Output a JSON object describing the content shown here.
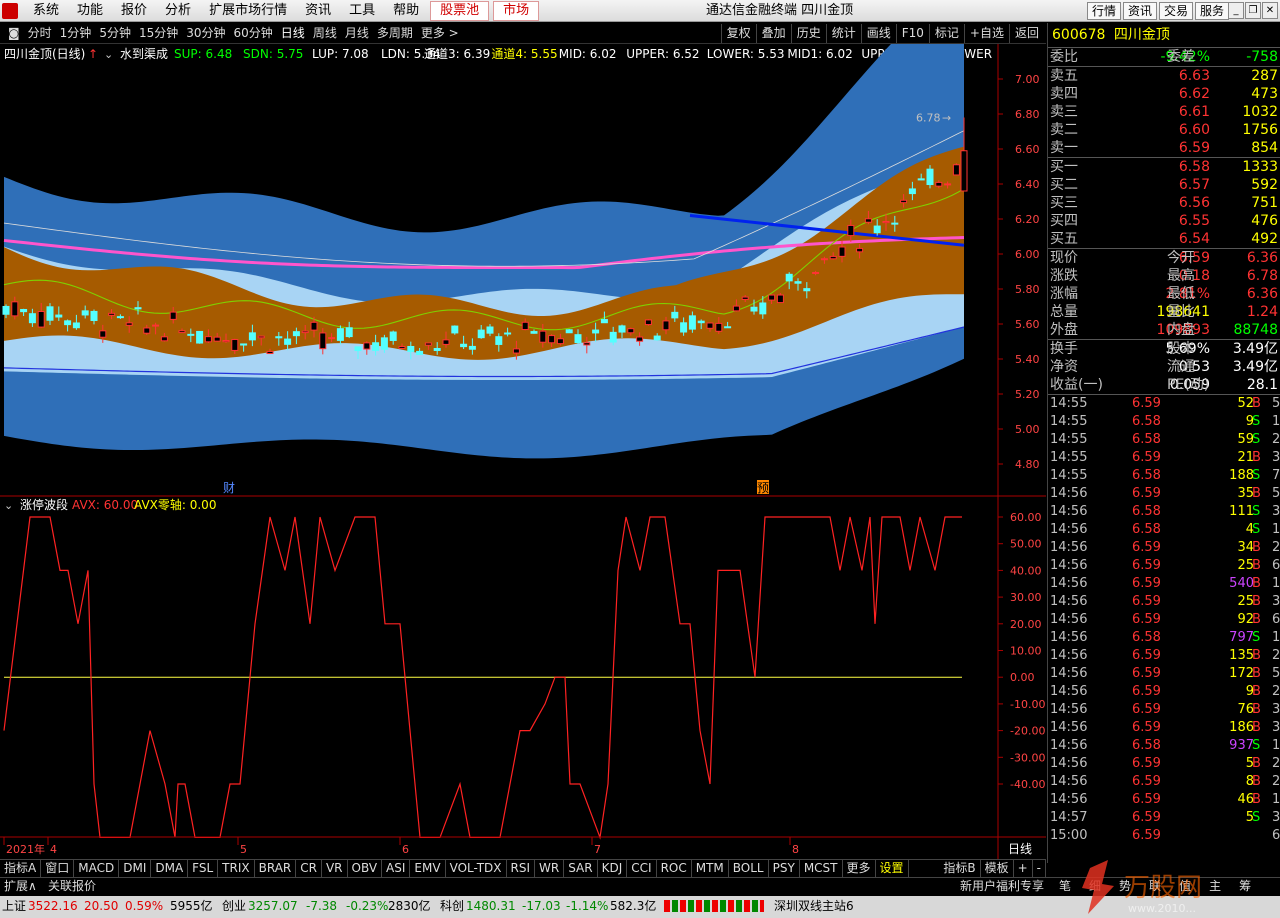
{
  "menubar": {
    "items": [
      "系统",
      "功能",
      "报价",
      "分析",
      "扩展市场行情",
      "资讯",
      "工具",
      "帮助"
    ],
    "red_items": [
      "股票池",
      "市场"
    ],
    "app_title": "通达信金融终端  四川金顶",
    "right_buttons": [
      "行情",
      "资讯",
      "交易",
      "服务"
    ]
  },
  "periodbar": {
    "items": [
      "分时",
      "1分钟",
      "5分钟",
      "15分钟",
      "30分钟",
      "60分钟",
      "日线",
      "周线",
      "月线",
      "多周期",
      "更多 >"
    ],
    "active": "日线",
    "right": [
      "复权",
      "叠加",
      "历史",
      "统计",
      "画线",
      "F10",
      "标记",
      "+自选",
      "返回"
    ]
  },
  "main_chart": {
    "title": "四川金顶(日线)",
    "indicator": "水到渠成",
    "params": [
      {
        "label": "SUP: 6.48",
        "color": "#00ff00"
      },
      {
        "label": "SDN: 5.75",
        "color": "#00ff00"
      },
      {
        "label": "LUP: 7.08",
        "color": "#ffffff"
      },
      {
        "label": "LDN: 5.34",
        "color": "#ffffff"
      }
    ],
    "params2": [
      {
        "label": "通道3: 6.39",
        "color": "#ffffff"
      },
      {
        "label": "通道4: 5.55",
        "color": "#ffff00"
      },
      {
        "label": "MID: 6.02",
        "color": "#ffffff"
      },
      {
        "label": "UPPER: 6.52",
        "color": "#ffffff"
      },
      {
        "label": "LOWER: 5.53",
        "color": "#ffffff"
      },
      {
        "label": "MID1: 6.02",
        "color": "#ffffff"
      },
      {
        "label": "UPPER1: 6.52",
        "color": "#ffffff"
      },
      {
        "label": "LOWER",
        "color": "#ffffff"
      }
    ],
    "y_ticks": [
      "7.00",
      "6.80",
      "6.60",
      "6.40",
      "6.20",
      "6.00",
      "5.80",
      "5.60",
      "5.40",
      "5.20",
      "5.00",
      "4.80"
    ],
    "y_tick_values": [
      7.0,
      6.8,
      6.6,
      6.4,
      6.2,
      6.0,
      5.8,
      5.6,
      5.4,
      5.2,
      5.0,
      4.8
    ],
    "max_label": "6.78",
    "marker_cai": "财",
    "marker_yu": "预"
  },
  "sub_chart": {
    "title": "涨停波段",
    "avx_label": "AVX: 60.00",
    "zero_label": "AVX零轴: 0.00",
    "y_ticks": [
      "60.00",
      "50.00",
      "40.00",
      "30.00",
      "20.00",
      "10.00",
      "0.00",
      "-10.00",
      "-20.00",
      "-30.00",
      "-40.00"
    ],
    "y_tick_values": [
      60,
      50,
      40,
      30,
      20,
      10,
      0,
      -10,
      -20,
      -30,
      -40
    ]
  },
  "x_axis": {
    "labels": [
      "2021年",
      "4",
      "5",
      "6",
      "7",
      "8"
    ],
    "period": "日线"
  },
  "quote": {
    "code": "600678",
    "name": "四川金顶",
    "weibi_label": "委比",
    "weibi": "-9.42%",
    "weicha_label": "委差",
    "weicha": "-758",
    "sells": [
      {
        "label": "卖五",
        "price": "6.63",
        "vol": "287"
      },
      {
        "label": "卖四",
        "price": "6.62",
        "vol": "473"
      },
      {
        "label": "卖三",
        "price": "6.61",
        "vol": "1032"
      },
      {
        "label": "卖二",
        "price": "6.60",
        "vol": "1756"
      },
      {
        "label": "卖一",
        "price": "6.59",
        "vol": "854"
      }
    ],
    "buys": [
      {
        "label": "买一",
        "price": "6.58",
        "vol": "1333"
      },
      {
        "label": "买二",
        "price": "6.57",
        "vol": "592"
      },
      {
        "label": "买三",
        "price": "6.56",
        "vol": "751"
      },
      {
        "label": "买四",
        "price": "6.55",
        "vol": "476"
      },
      {
        "label": "买五",
        "price": "6.54",
        "vol": "492"
      }
    ],
    "stats": [
      {
        "a": "现价",
        "b": "6.59",
        "c": "今开",
        "d": "6.36",
        "bcol": "#ff3333",
        "dcol": "#ff3333"
      },
      {
        "a": "涨跌",
        "b": "0.18",
        "c": "最高",
        "d": "6.78",
        "bcol": "#ff3333",
        "dcol": "#ff3333"
      },
      {
        "a": "涨幅",
        "b": "2.81%",
        "c": "最低",
        "d": "6.36",
        "bcol": "#ff3333",
        "dcol": "#ff3333"
      },
      {
        "a": "总量",
        "b": "198641",
        "c": "量比",
        "d": "1.24",
        "bcol": "#ffff00",
        "dcol": "#ff3333"
      },
      {
        "a": "外盘",
        "b": "109893",
        "c": "内盘",
        "d": "88748",
        "bcol": "#ff3333",
        "dcol": "#00ff00"
      }
    ],
    "stats2": [
      {
        "a": "换手",
        "b": "5.69%",
        "c": "股本",
        "d": "3.49亿",
        "bcol": "#ffffff",
        "dcol": "#ffffff"
      },
      {
        "a": "净资",
        "b": "0.53",
        "c": "流通",
        "d": "3.49亿",
        "bcol": "#ffffff",
        "dcol": "#ffffff"
      },
      {
        "a": "收益(一)",
        "b": "0.059",
        "c": "PE(动)",
        "d": "28.1",
        "bcol": "#ffffff",
        "dcol": "#ffffff"
      }
    ],
    "ticks": [
      {
        "t": "14:55",
        "p": "6.59",
        "v": "52",
        "s": "B",
        "n": "5"
      },
      {
        "t": "14:55",
        "p": "6.58",
        "v": "9",
        "s": "S",
        "n": "1"
      },
      {
        "t": "14:55",
        "p": "6.58",
        "v": "59",
        "s": "S",
        "n": "2"
      },
      {
        "t": "14:55",
        "p": "6.59",
        "v": "21",
        "s": "B",
        "n": "3"
      },
      {
        "t": "14:55",
        "p": "6.58",
        "v": "188",
        "s": "S",
        "n": "7"
      },
      {
        "t": "14:56",
        "p": "6.59",
        "v": "35",
        "s": "B",
        "n": "5"
      },
      {
        "t": "14:56",
        "p": "6.58",
        "v": "111",
        "s": "S",
        "n": "3"
      },
      {
        "t": "14:56",
        "p": "6.58",
        "v": "4",
        "s": "S",
        "n": "1"
      },
      {
        "t": "14:56",
        "p": "6.59",
        "v": "34",
        "s": "B",
        "n": "2"
      },
      {
        "t": "14:56",
        "p": "6.59",
        "v": "25",
        "s": "B",
        "n": "6"
      },
      {
        "t": "14:56",
        "p": "6.59",
        "v": "540",
        "s": "B",
        "n": "11",
        "purple": true
      },
      {
        "t": "14:56",
        "p": "6.59",
        "v": "25",
        "s": "B",
        "n": "3"
      },
      {
        "t": "14:56",
        "p": "6.59",
        "v": "92",
        "s": "B",
        "n": "6"
      },
      {
        "t": "14:56",
        "p": "6.58",
        "v": "797",
        "s": "S",
        "n": "1",
        "purple": true
      },
      {
        "t": "14:56",
        "p": "6.59",
        "v": "135",
        "s": "B",
        "n": "2"
      },
      {
        "t": "14:56",
        "p": "6.59",
        "v": "172",
        "s": "B",
        "n": "5"
      },
      {
        "t": "14:56",
        "p": "6.59",
        "v": "9",
        "s": "B",
        "n": "2"
      },
      {
        "t": "14:56",
        "p": "6.59",
        "v": "76",
        "s": "B",
        "n": "3"
      },
      {
        "t": "14:56",
        "p": "6.59",
        "v": "186",
        "s": "B",
        "n": "3"
      },
      {
        "t": "14:56",
        "p": "6.58",
        "v": "937",
        "s": "S",
        "n": "14",
        "purple": true
      },
      {
        "t": "14:56",
        "p": "6.59",
        "v": "5",
        "s": "B",
        "n": "2"
      },
      {
        "t": "14:56",
        "p": "6.59",
        "v": "8",
        "s": "B",
        "n": "2"
      },
      {
        "t": "14:56",
        "p": "6.59",
        "v": "46",
        "s": "B",
        "n": "1"
      },
      {
        "t": "14:57",
        "p": "6.59",
        "v": "5",
        "s": "S",
        "n": "3"
      },
      {
        "t": "15:00",
        "p": "6.59",
        "v": "",
        "s": "",
        "n": "6"
      }
    ]
  },
  "tabs": [
    "指标A",
    "窗口",
    "MACD",
    "DMI",
    "DMA",
    "FSL",
    "TRIX",
    "BRAR",
    "CR",
    "VR",
    "OBV",
    "ASI",
    "EMV",
    "VOL-TDX",
    "RSI",
    "WR",
    "SAR",
    "KDJ",
    "CCI",
    "ROC",
    "MTM",
    "BOLL",
    "PSY",
    "MCST",
    "更多",
    "设置"
  ],
  "tabs_right": [
    "指标B",
    "模板",
    "+",
    "-"
  ],
  "subbar": {
    "left": "扩展∧",
    "mid": "关联报价",
    "right": "新用户福利专享",
    "rtabs": [
      "笔",
      "细",
      "势",
      "联",
      "值",
      "主",
      "筹"
    ]
  },
  "status": {
    "sh": {
      "label": "上证",
      "v": "3522.16",
      "c": "20.50",
      "p": "0.59%",
      "amt": "5955亿"
    },
    "cy": {
      "label": "创业",
      "v": "3257.07",
      "c": "-7.38",
      "p": "-0.23%",
      "amt": "2830亿"
    },
    "kc": {
      "label": "科创",
      "v": "1480.31",
      "c": "-17.03",
      "p": "-1.14%",
      "amt": "582.3亿"
    },
    "server": "深圳双线主站6"
  },
  "watermark": {
    "text": "万股网",
    "url": "www.2010..."
  }
}
